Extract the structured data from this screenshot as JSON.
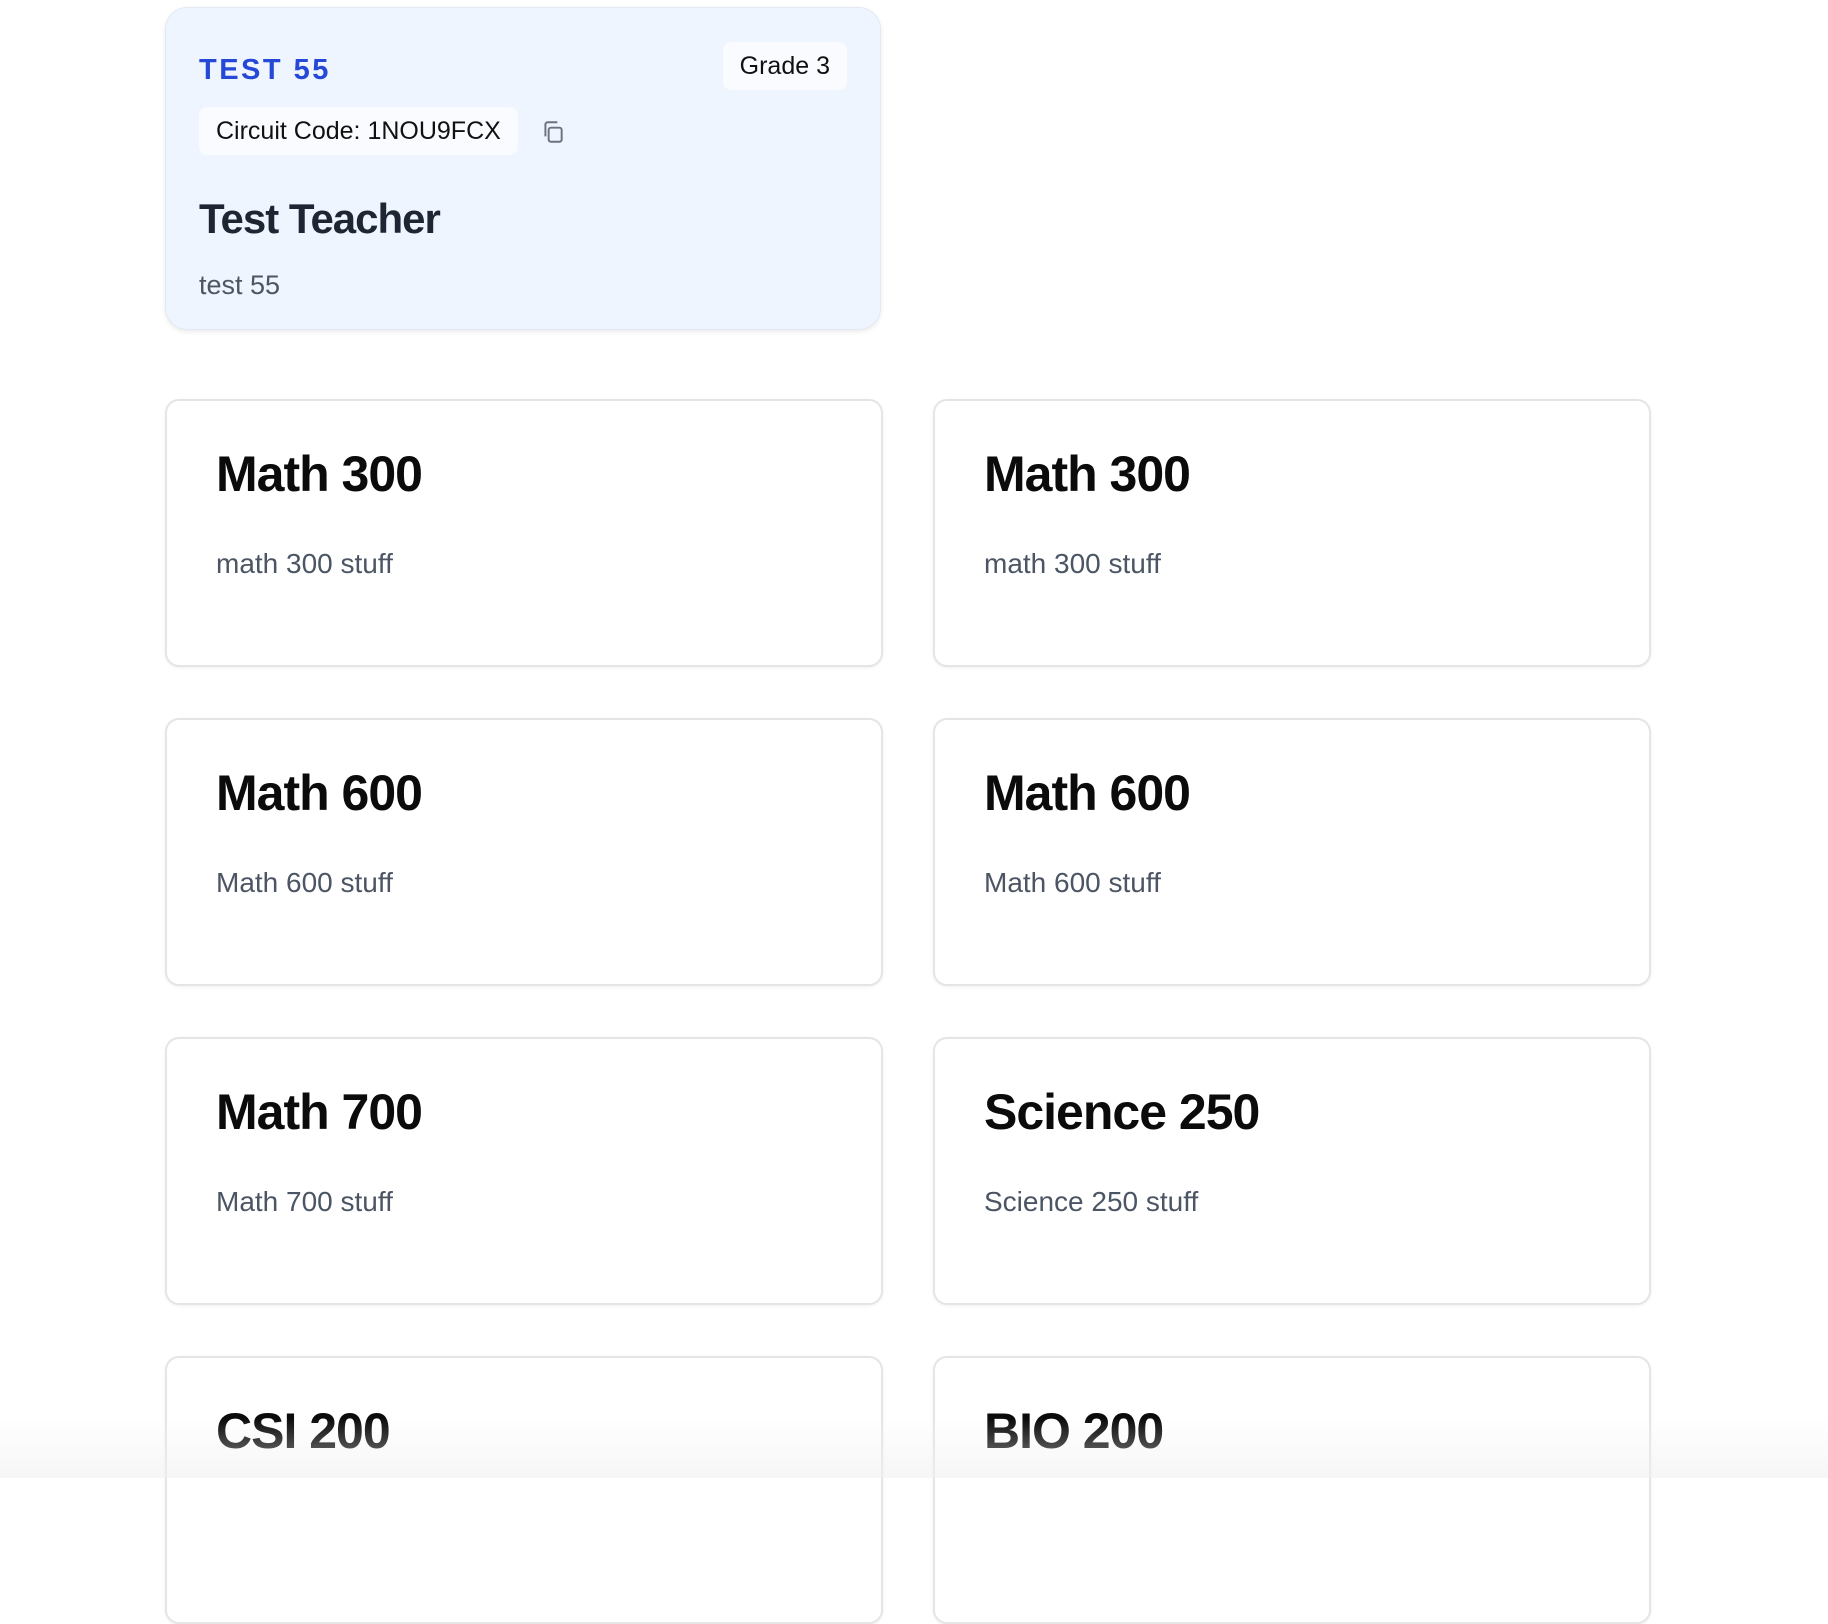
{
  "circuit": {
    "code_label": "TEST 55",
    "grade": "Grade 3",
    "circuit_code": "Circuit Code: 1NOU9FCX",
    "teacher": "Test Teacher",
    "description": "test 55",
    "accent_color": "#2549d6"
  },
  "classes": [
    {
      "title": "Math 300",
      "description": "math 300 stuff"
    },
    {
      "title": "Math 300",
      "description": "math 300 stuff"
    },
    {
      "title": "Math 600",
      "description": "Math 600 stuff"
    },
    {
      "title": "Math 600",
      "description": "Math 600 stuff"
    },
    {
      "title": "Math 700",
      "description": "Math 700 stuff"
    },
    {
      "title": "Science 250",
      "description": "Science 250 stuff"
    },
    {
      "title": "CSI 200",
      "description": ""
    },
    {
      "title": "BIO 200",
      "description": ""
    }
  ]
}
